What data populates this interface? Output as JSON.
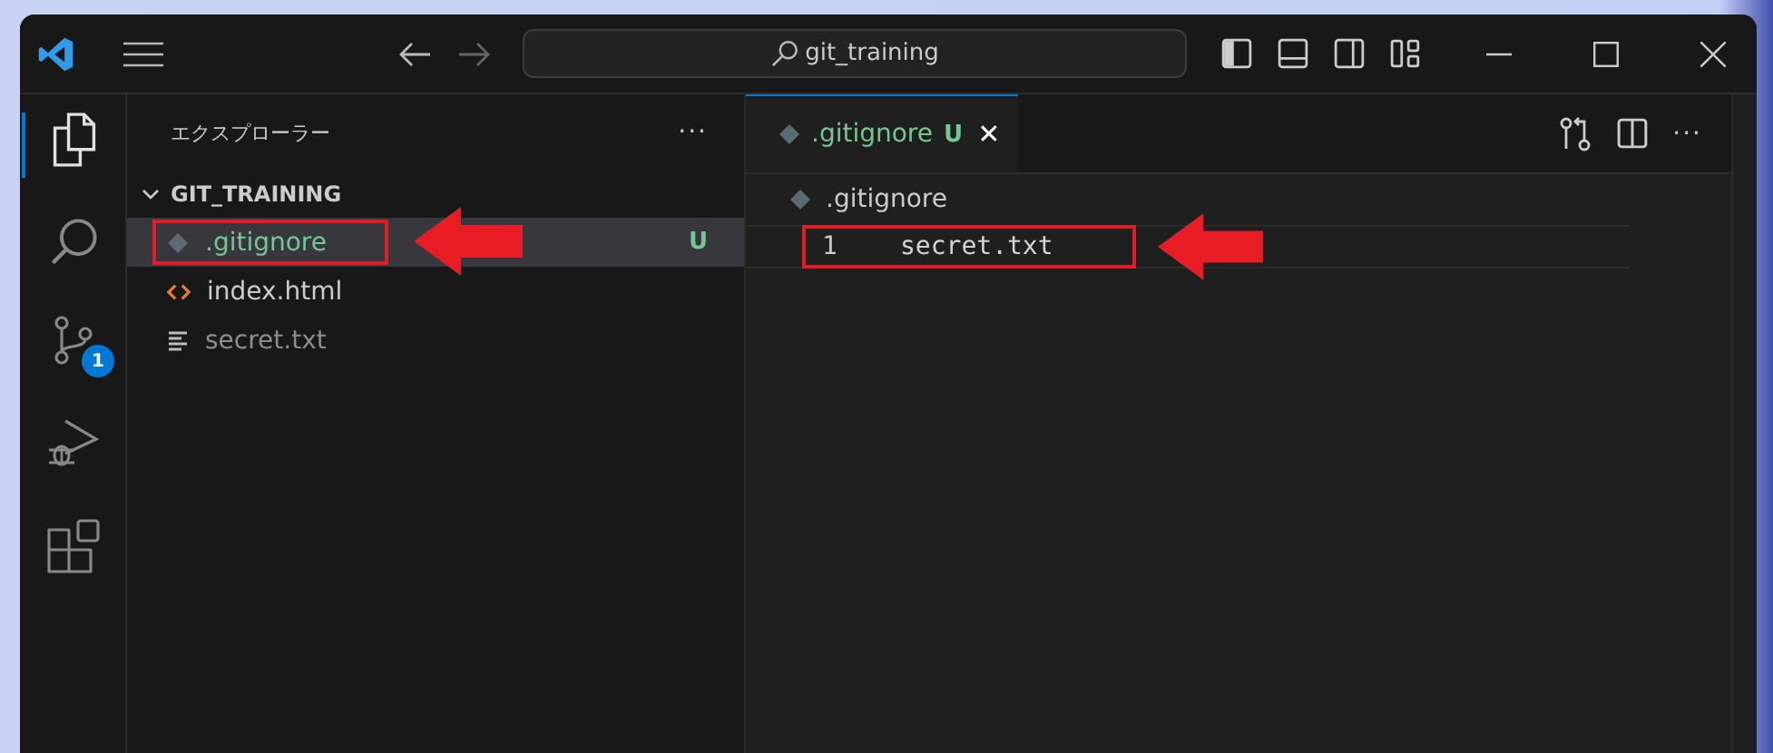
{
  "title_bar": {
    "search": "git_training"
  },
  "activity_bar": {
    "items": [
      {
        "kind": "files",
        "selected": true
      },
      {
        "kind": "search",
        "selected": false
      },
      {
        "kind": "source-control",
        "selected": false,
        "badge": "1"
      },
      {
        "kind": "run-debug",
        "selected": false
      },
      {
        "kind": "extensions",
        "selected": false
      }
    ]
  },
  "sidebar": {
    "title": "エクスプローラー",
    "more": "···",
    "folder": {
      "name": "GIT_TRAINING",
      "expanded": true,
      "children": [
        {
          "name": ".gitignore",
          "kind": "git",
          "selected": true,
          "status": "U",
          "ignored": false,
          "highlighted": true
        },
        {
          "name": "index.html",
          "kind": "html",
          "selected": false,
          "ignored": false,
          "highlighted": false
        },
        {
          "name": "secret.txt",
          "kind": "text",
          "selected": false,
          "ignored": true,
          "highlighted": false
        }
      ]
    }
  },
  "editor": {
    "tabs": [
      {
        "name": ".gitignore",
        "status": "U",
        "close": "✕",
        "selected": true
      }
    ],
    "more": "···",
    "breadcrumb": ".gitignore",
    "lines": [
      {
        "number": "1",
        "text": "secret.txt",
        "highlighted": true
      }
    ]
  }
}
